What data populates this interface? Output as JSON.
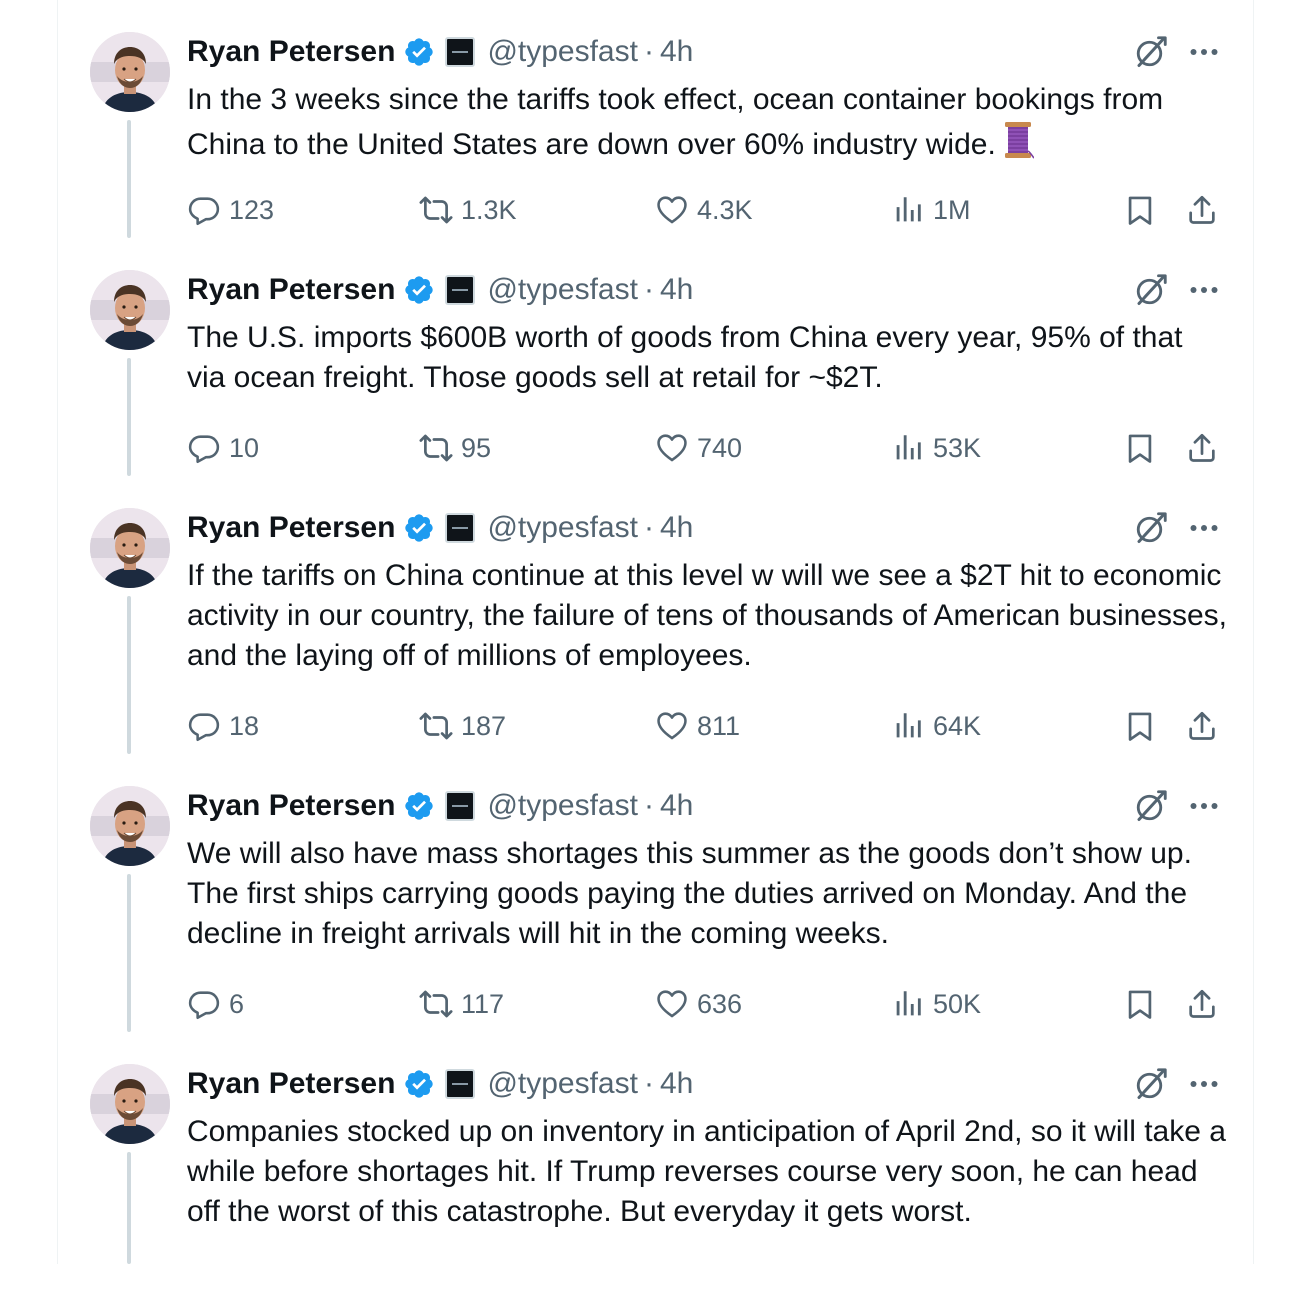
{
  "tweets": [
    {
      "author": "Ryan Petersen",
      "handle": "@typesfast",
      "separator": "·",
      "time": "4h",
      "text": "In the 3 weeks since the tariffs took effect, ocean container bookings from China to the United States are down over 60% industry wide.",
      "emoji_icon": "thread-spool-icon",
      "replies": "123",
      "retweets": "1.3K",
      "likes": "4.3K",
      "views": "1M"
    },
    {
      "author": "Ryan Petersen",
      "handle": "@typesfast",
      "separator": "·",
      "time": "4h",
      "text": "The U.S. imports $600B worth of goods from China every year, 95% of that via ocean freight. Those goods sell at retail for ~$2T.",
      "replies": "10",
      "retweets": "95",
      "likes": "740",
      "views": "53K"
    },
    {
      "author": "Ryan Petersen",
      "handle": "@typesfast",
      "separator": "·",
      "time": "4h",
      "text": "If the tariffs on China continue at this level w will we see a $2T hit to economic activity in our country, the failure of tens of thousands of American businesses, and the laying off of millions of employees.",
      "replies": "18",
      "retweets": "187",
      "likes": "811",
      "views": "64K"
    },
    {
      "author": "Ryan Petersen",
      "handle": "@typesfast",
      "separator": "·",
      "time": "4h",
      "text": "We will also have mass shortages this summer as the goods don’t show up. The first ships carrying goods paying the duties arrived on Monday. And the decline in freight arrivals will hit in the coming weeks.",
      "replies": "6",
      "retweets": "117",
      "likes": "636",
      "views": "50K"
    },
    {
      "author": "Ryan Petersen",
      "handle": "@typesfast",
      "separator": "·",
      "time": "4h",
      "text": "Companies stocked up on inventory in anticipation of April 2nd, so it will take a while before shortages hit. If Trump reverses course very soon, he can head off the worst of this catastrophe. But everyday it gets worst."
    }
  ],
  "colors": {
    "text": "#0f1419",
    "secondary": "#536471",
    "verified": "#1d9bf0",
    "thread_line": "#cfd9de"
  }
}
